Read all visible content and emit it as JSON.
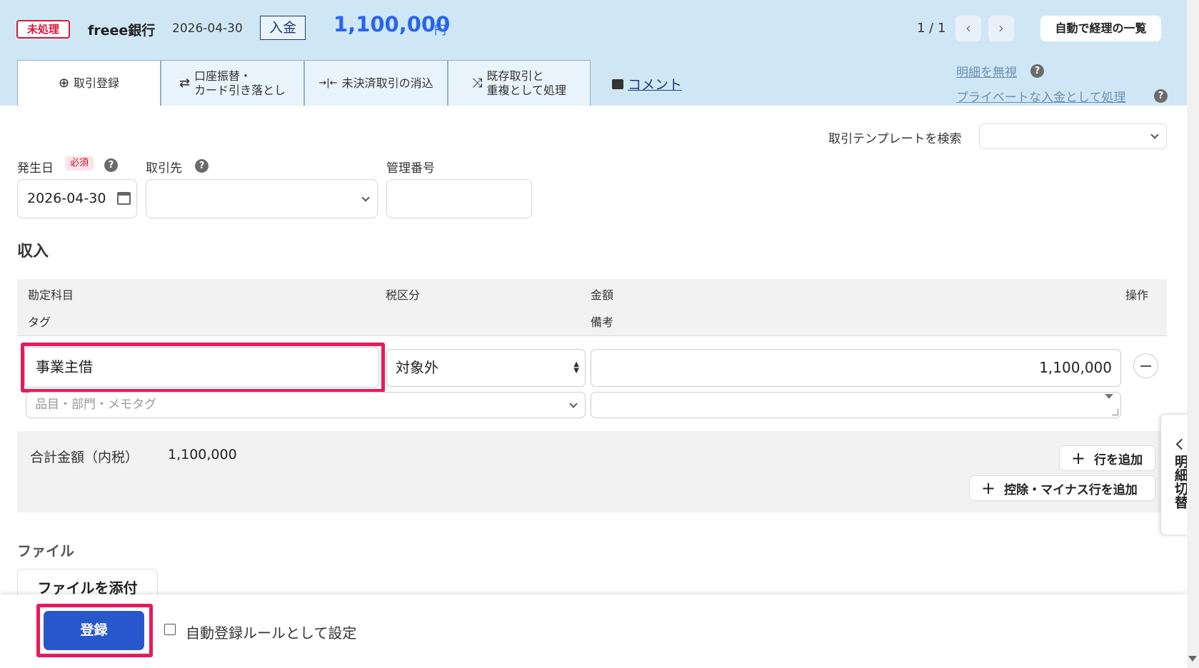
{
  "header": {
    "status": "未処理",
    "bank": "freee銀行",
    "date": "2026-04-30",
    "type": "入金",
    "amount": "1,100,000",
    "currency": "円",
    "pager": "1 / 1",
    "prev": "‹",
    "next": "›",
    "list_button": "自動で経理の一覧"
  },
  "tabs": [
    {
      "icon": "⊕",
      "label": "取引登録"
    },
    {
      "icon": "⇄",
      "label": "口座振替・\nカード引き落とし"
    },
    {
      "icon": "→|←",
      "label": "未決済取引の消込"
    },
    {
      "icon": "⤨",
      "label": "既存取引と\n重複として処理"
    }
  ],
  "comment_tab": "コメント",
  "links": {
    "ignore": "明細を無視",
    "private": "プライベートな入金として処理"
  },
  "template": {
    "label": "取引テンプレートを検索",
    "value": ""
  },
  "fields": {
    "date_label": "発生日",
    "required": "必須",
    "date_value": "2026-04-30",
    "partner_label": "取引先",
    "partner_value": "",
    "mgmt_label": "管理番号",
    "mgmt_value": ""
  },
  "section": {
    "title": "収入"
  },
  "table": {
    "headers": {
      "account": "勘定科目",
      "tax": "税区分",
      "amount": "金額",
      "action": "操作",
      "tag": "タグ",
      "memo": "備考"
    },
    "row": {
      "account": "事業主借",
      "tax": "対象外",
      "amount": "1,100,000",
      "tag_placeholder": "品目・部門・メモタグ",
      "memo": ""
    }
  },
  "total": {
    "label": "合計金額（内税）",
    "value": "1,100,000",
    "add_row": "行を追加",
    "add_deduction": "控除・マイナス行を追加"
  },
  "files": {
    "title": "ファイル",
    "attach": "ファイルを添付"
  },
  "footer": {
    "register": "登録",
    "auto_rule": "自動登録ルールとして設定"
  },
  "side_tab": {
    "label": "明細切替"
  },
  "colors": {
    "header_bg": "#cfe7f5",
    "accent": "#2864f0",
    "primary_button": "#2857cc",
    "status_red": "#d7193b",
    "highlight": "#e8195c"
  }
}
